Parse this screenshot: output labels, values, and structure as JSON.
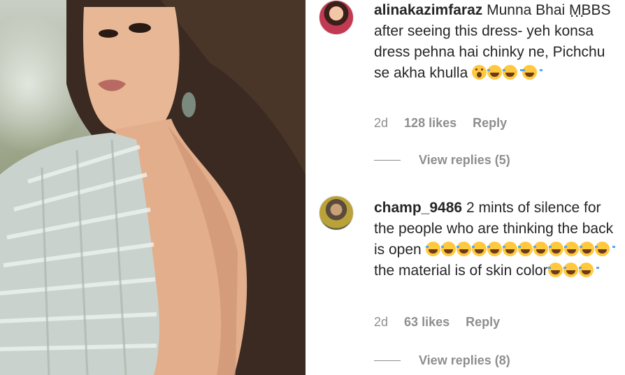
{
  "comments": [
    {
      "username": "alinakazimfaraz",
      "text": "Munna Bhai MBBS after seeing this dress- yeh konsa dress pehna hai chinky ne, Pichchu se akha khulla",
      "emojis_after": [
        "face-with-open-mouth",
        "face-with-tears-of-joy",
        "face-with-tears-of-joy",
        "face-with-tears-of-joy"
      ],
      "age": "2d",
      "likes": "128 likes",
      "reply": "Reply",
      "view_replies": "View replies (5)"
    },
    {
      "username": "champ_9486",
      "text_part1": "2 mints of silence for the people who are thinking the back is open",
      "text_part2": "the material is of skin color",
      "emojis_mid": [
        "face-with-tears-of-joy",
        "face-with-tears-of-joy",
        "face-with-tears-of-joy",
        "face-with-tears-of-joy",
        "face-with-tears-of-joy",
        "face-with-tears-of-joy",
        "face-with-tears-of-joy",
        "face-with-tears-of-joy",
        "face-with-tears-of-joy",
        "face-with-tears-of-joy",
        "face-with-tears-of-joy",
        "face-with-tears-of-joy"
      ],
      "emojis_after": [
        "face-with-tears-of-joy",
        "face-with-tears-of-joy",
        "face-with-tears-of-joy"
      ],
      "age": "2d",
      "likes": "63 likes",
      "reply": "Reply",
      "view_replies": "View replies (8)"
    }
  ],
  "more_glyph": "...",
  "colors": {
    "text": "#262626",
    "meta": "#8e8e8e",
    "background": "#ffffff"
  }
}
